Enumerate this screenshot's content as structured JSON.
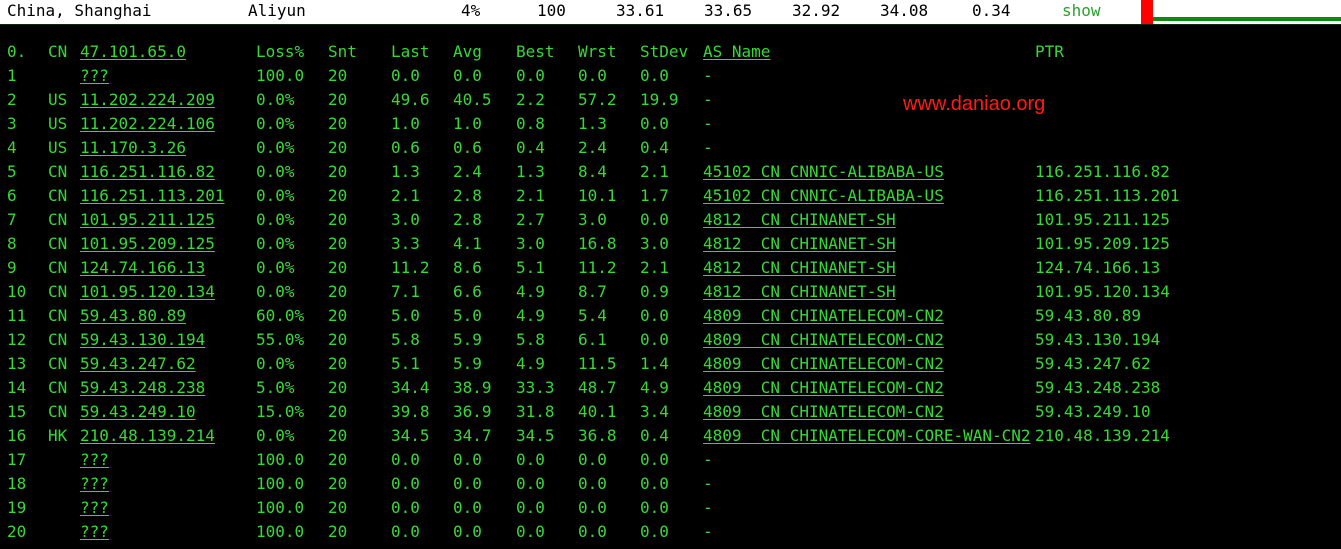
{
  "topbar": {
    "location": "China, Shanghai",
    "provider": "Aliyun",
    "loss": "4%",
    "sent": "100",
    "last": "33.61",
    "avg": "33.65",
    "best": "32.92",
    "worst": "34.08",
    "stdev": "0.34",
    "show_label": "show",
    "marker_color": "#ff0000",
    "line_color": "#0b8a0b"
  },
  "watermark": "www.daniao.org",
  "header": [
    "0.",
    "CN",
    "47.101.65.0",
    "Loss%",
    "Snt",
    "Last",
    "Avg",
    "Best",
    "Wrst",
    "StDev",
    "AS Name",
    "PTR"
  ],
  "rows": [
    [
      "1",
      "",
      "???",
      "100.0",
      "20",
      "0.0",
      "0.0",
      "0.0",
      "0.0",
      "0.0",
      "-",
      ""
    ],
    [
      "2",
      "US",
      "11.202.224.209",
      "0.0%",
      "20",
      "49.6",
      "40.5",
      "2.2",
      "57.2",
      "19.9",
      "-",
      ""
    ],
    [
      "3",
      "US",
      "11.202.224.106",
      "0.0%",
      "20",
      "1.0",
      "1.0",
      "0.8",
      "1.3",
      "0.0",
      "-",
      ""
    ],
    [
      "4",
      "US",
      "11.170.3.26",
      "0.0%",
      "20",
      "0.6",
      "0.6",
      "0.4",
      "2.4",
      "0.4",
      "-",
      ""
    ],
    [
      "5",
      "CN",
      "116.251.116.82",
      "0.0%",
      "20",
      "1.3",
      "2.4",
      "1.3",
      "8.4",
      "2.1",
      "45102 CN CNNIC-ALIBABA-US",
      "116.251.116.82"
    ],
    [
      "6",
      "CN",
      "116.251.113.201",
      "0.0%",
      "20",
      "2.1",
      "2.8",
      "2.1",
      "10.1",
      "1.7",
      "45102 CN CNNIC-ALIBABA-US",
      "116.251.113.201"
    ],
    [
      "7",
      "CN",
      "101.95.211.125",
      "0.0%",
      "20",
      "3.0",
      "2.8",
      "2.7",
      "3.0",
      "0.0",
      "4812  CN CHINANET-SH",
      "101.95.211.125"
    ],
    [
      "8",
      "CN",
      "101.95.209.125",
      "0.0%",
      "20",
      "3.3",
      "4.1",
      "3.0",
      "16.8",
      "3.0",
      "4812  CN CHINANET-SH",
      "101.95.209.125"
    ],
    [
      "9",
      "CN",
      "124.74.166.13",
      "0.0%",
      "20",
      "11.2",
      "8.6",
      "5.1",
      "11.2",
      "2.1",
      "4812  CN CHINANET-SH",
      "124.74.166.13"
    ],
    [
      "10",
      "CN",
      "101.95.120.134",
      "0.0%",
      "20",
      "7.1",
      "6.6",
      "4.9",
      "8.7",
      "0.9",
      "4812  CN CHINANET-SH",
      "101.95.120.134"
    ],
    [
      "11",
      "CN",
      "59.43.80.89",
      "60.0%",
      "20",
      "5.0",
      "5.0",
      "4.9",
      "5.4",
      "0.0",
      "4809  CN CHINATELECOM-CN2",
      "59.43.80.89"
    ],
    [
      "12",
      "CN",
      "59.43.130.194",
      "55.0%",
      "20",
      "5.8",
      "5.9",
      "5.8",
      "6.1",
      "0.0",
      "4809  CN CHINATELECOM-CN2",
      "59.43.130.194"
    ],
    [
      "13",
      "CN",
      "59.43.247.62",
      "0.0%",
      "20",
      "5.1",
      "5.9",
      "4.9",
      "11.5",
      "1.4",
      "4809  CN CHINATELECOM-CN2",
      "59.43.247.62"
    ],
    [
      "14",
      "CN",
      "59.43.248.238",
      "5.0%",
      "20",
      "34.4",
      "38.9",
      "33.3",
      "48.7",
      "4.9",
      "4809  CN CHINATELECOM-CN2",
      "59.43.248.238"
    ],
    [
      "15",
      "CN",
      "59.43.249.10",
      "15.0%",
      "20",
      "39.8",
      "36.9",
      "31.8",
      "40.1",
      "3.4",
      "4809  CN CHINATELECOM-CN2",
      "59.43.249.10"
    ],
    [
      "16",
      "HK",
      "210.48.139.214",
      "0.0%",
      "20",
      "34.5",
      "34.7",
      "34.5",
      "36.8",
      "0.4",
      "4809  CN CHINATELECOM-CORE-WAN-CN2",
      "210.48.139.214"
    ],
    [
      "17",
      "",
      "???",
      "100.0",
      "20",
      "0.0",
      "0.0",
      "0.0",
      "0.0",
      "0.0",
      "-",
      ""
    ],
    [
      "18",
      "",
      "???",
      "100.0",
      "20",
      "0.0",
      "0.0",
      "0.0",
      "0.0",
      "0.0",
      "-",
      ""
    ],
    [
      "19",
      "",
      "???",
      "100.0",
      "20",
      "0.0",
      "0.0",
      "0.0",
      "0.0",
      "0.0",
      "-",
      ""
    ],
    [
      "20",
      "",
      "???",
      "100.0",
      "20",
      "0.0",
      "0.0",
      "0.0",
      "0.0",
      "0.0",
      "-",
      ""
    ]
  ]
}
